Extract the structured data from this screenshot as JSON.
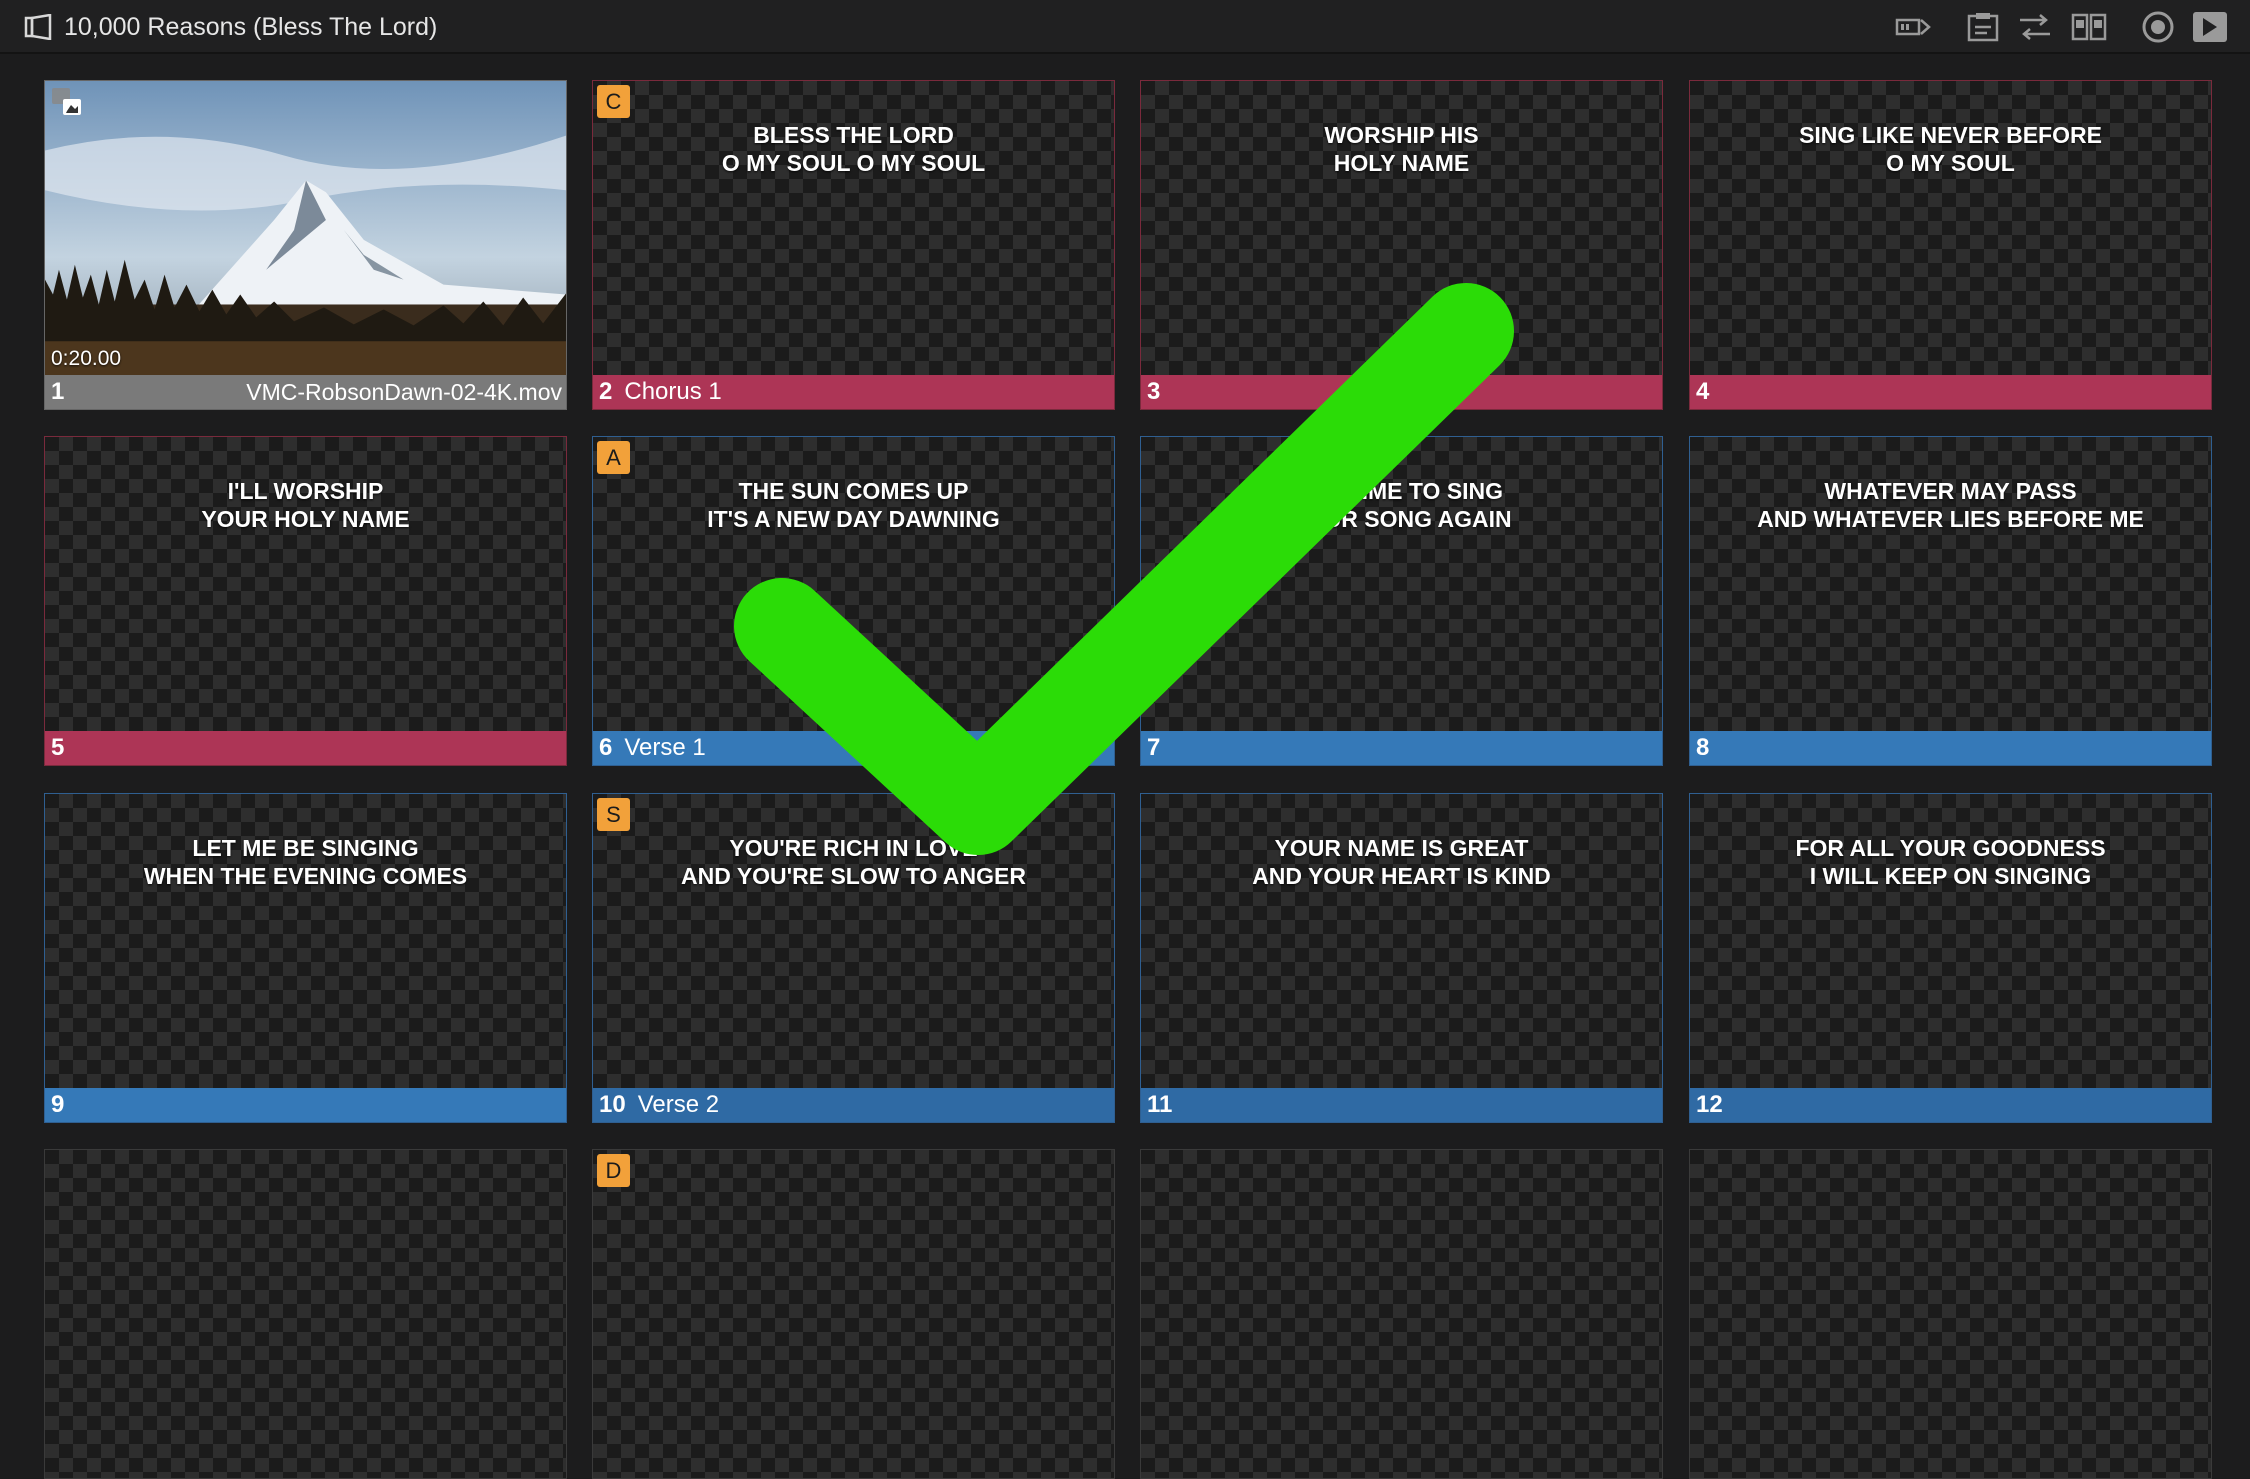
{
  "window": {
    "title": "10,000 Reasons (Bless The Lord)"
  },
  "toolbar": {
    "icons": [
      "slide-transition-icon",
      "clipboard-icon",
      "arrangement-icon",
      "split-view-icon",
      "record-icon",
      "play-forward-icon"
    ]
  },
  "colors": {
    "chorus": "#ad3556",
    "verse": "#3579b8",
    "badge": "#f2a13a",
    "check": "#2bdc07"
  },
  "slides": [
    {
      "num": "1",
      "label": "",
      "text": "",
      "media": {
        "file": "VMC-RobsonDawn-02-4K.mov",
        "duration": "0:20.00"
      }
    },
    {
      "num": "2",
      "label": "Chorus 1",
      "text": "BLESS THE LORD\nO MY SOUL O MY SOUL",
      "badge": "C"
    },
    {
      "num": "3",
      "label": "",
      "text": "WORSHIP HIS\nHOLY NAME"
    },
    {
      "num": "4",
      "label": "",
      "text": "SING LIKE NEVER BEFORE\nO MY SOUL"
    },
    {
      "num": "5",
      "label": "",
      "text": "I'LL WORSHIP\nYOUR HOLY NAME"
    },
    {
      "num": "6",
      "label": "Verse 1",
      "text": "THE SUN COMES UP\nIT'S A NEW DAY DAWNING",
      "badge": "A"
    },
    {
      "num": "7",
      "label": "",
      "text": "IT'S TIME TO SING\nYOUR SONG AGAIN"
    },
    {
      "num": "8",
      "label": "",
      "text": "WHATEVER MAY PASS\nAND WHATEVER LIES BEFORE ME"
    },
    {
      "num": "9",
      "label": "",
      "text": "LET ME BE SINGING\nWHEN THE EVENING COMES"
    },
    {
      "num": "10",
      "label": "Verse 2",
      "text": "YOU'RE RICH IN LOVE\nAND YOU'RE SLOW TO ANGER",
      "badge": "S"
    },
    {
      "num": "11",
      "label": "",
      "text": "YOUR NAME IS GREAT\nAND YOUR HEART IS KIND"
    },
    {
      "num": "12",
      "label": "",
      "text": "FOR ALL YOUR GOODNESS\nI WILL KEEP ON SINGING"
    },
    {
      "num": "",
      "label": "",
      "text": ""
    },
    {
      "num": "",
      "label": "",
      "text": "",
      "badge": "D"
    },
    {
      "num": "",
      "label": "",
      "text": ""
    },
    {
      "num": "",
      "label": "",
      "text": ""
    }
  ]
}
